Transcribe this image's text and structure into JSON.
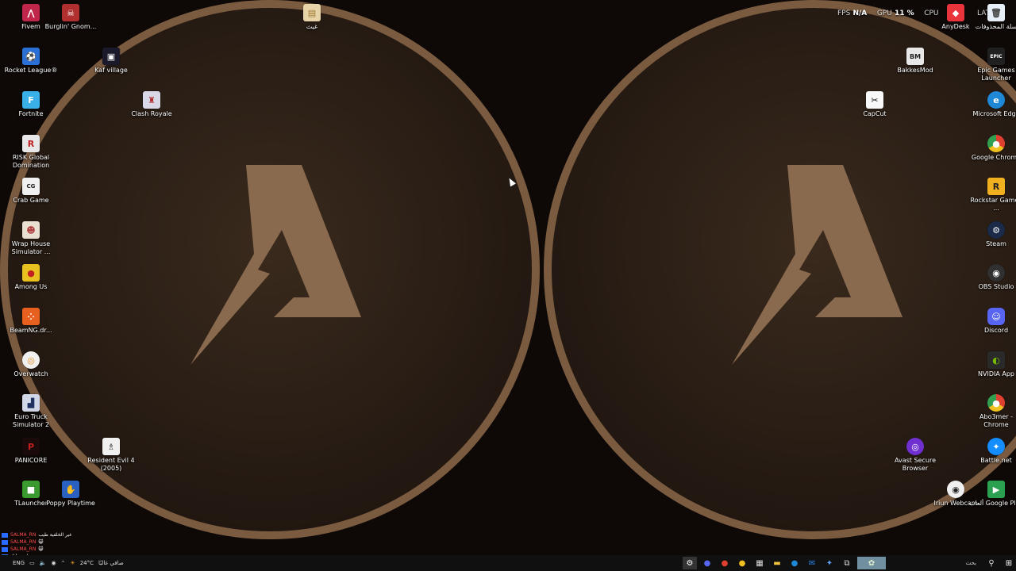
{
  "colors": {
    "background": "#0e0907",
    "wallpaper_circle": "#2a1e15",
    "wallpaper_ring": "#7a5b40",
    "logo": "#8a6a4e",
    "taskbar": "#101010"
  },
  "overlay": {
    "fps_label": "FPS",
    "fps_value": "N/A",
    "gpu_label": "GPU",
    "gpu_value": "11 %",
    "cpu_label": "CPU",
    "lat_label": "LAT"
  },
  "desktop_icons": {
    "fivem": "Fivem",
    "burglin": "Burglin' Gnom...",
    "ghaith": "غيث",
    "rocket_league": "Rocket League®",
    "kaf_village": "Kaf village",
    "fortnite": "Fortnite",
    "clash_royale": "Clash Royale",
    "risk": "RISK Global Domination",
    "crab_game": "Crab Game",
    "wrap_house": "Wrap House Simulator ...",
    "among_us": "Among Us",
    "beamng": "BeamNG.dr...",
    "overwatch": "Overwatch",
    "euro_truck": "Euro Truck Simulator 2",
    "panicore": "PANICORE",
    "resident_evil": "Resident Evil 4 (2005)",
    "tlauncher": "TLauncher",
    "poppy": "Poppy Playtime",
    "recycle_bin": "سلة المحذوفات",
    "anydesk": "AnyDesk",
    "bakkesmod": "BakkesMod",
    "epic": "Epic Games Launcher",
    "capcut": "CapCut",
    "edge": "Microsoft Edge",
    "chrome": "Google Chrome",
    "rockstar": "Rockstar Games ...",
    "steam": "Steam",
    "obs": "OBS Studio",
    "discord": "Discord",
    "nvidia": "NVIDIA App",
    "abo3mer": "Abo3mer - Chrome",
    "avast": "Avast Secure Browser",
    "battlenet": "Battle.net",
    "iriun": "Iriun Webcam",
    "google_play": "ألعاب Google Play"
  },
  "chat": {
    "lines": [
      {
        "user": "SALMA_RN",
        "text": "غير الخلفية طيب"
      },
      {
        "user": "SALMA_RN",
        "text": "😺"
      },
      {
        "user": "SALMA_RN",
        "text": "😺"
      },
      {
        "user": "",
        "text": "تابع حياتك"
      }
    ]
  },
  "taskbar": {
    "language": "ENG",
    "temperature": "24°C",
    "weather": "صافي غالبًا",
    "search_placeholder": "بحث"
  }
}
